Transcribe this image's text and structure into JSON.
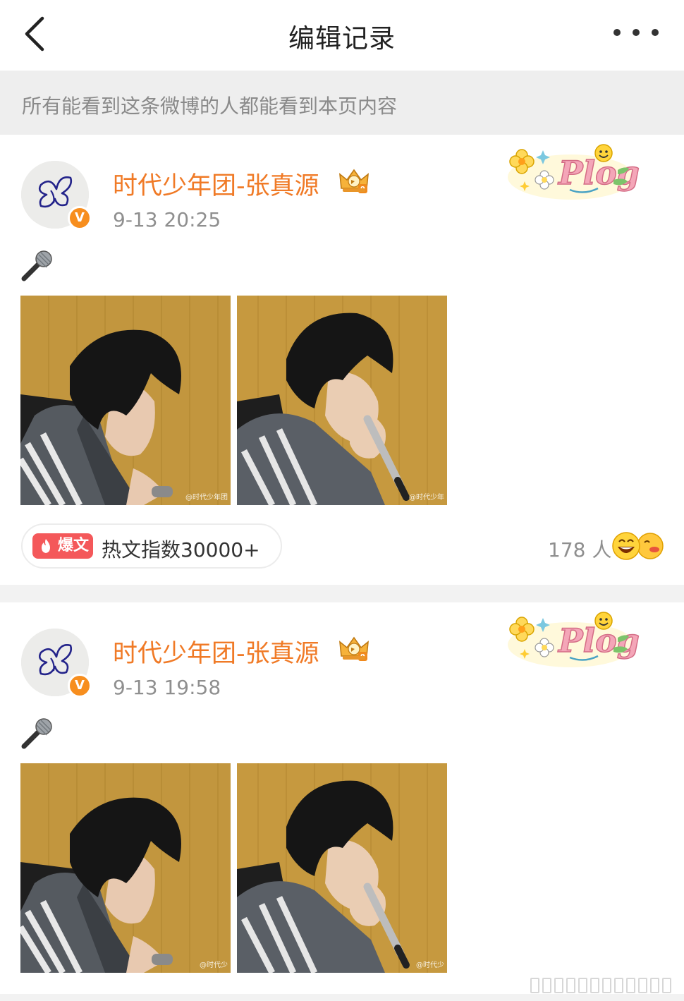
{
  "header": {
    "title": "编辑记录",
    "back_icon": "chevron-left-icon",
    "more_icon": "more-dots-icon"
  },
  "notice": {
    "text": "所有能看到这条微博的人都能看到本页内容"
  },
  "posts": [
    {
      "author": "时代少年团-张真源",
      "verified_icon": "verified-v-icon",
      "crown_icon": "crown-badge-icon",
      "sticker_icon": "plog-sticker-icon",
      "timestamp": "9-13 20:25",
      "content_emoji": "microphone-icon",
      "images": [
        {
          "name": "photo-looking-down",
          "watermark": "@时代少年团"
        },
        {
          "name": "photo-singing-microphone",
          "watermark": "@时代少年"
        }
      ],
      "hot_badge": "爆文",
      "hot_index": "热文指数30000+",
      "reaction_count": "178 人",
      "reaction_icon": "laugh-emoji-icon"
    },
    {
      "author": "时代少年团-张真源",
      "verified_icon": "verified-v-icon",
      "crown_icon": "crown-badge-icon",
      "sticker_icon": "plog-sticker-icon",
      "timestamp": "9-13 19:58",
      "content_emoji": "microphone-icon",
      "images": [
        {
          "name": "photo-looking-down",
          "watermark": "@时代少"
        },
        {
          "name": "photo-singing-microphone",
          "watermark": "@时代少"
        }
      ]
    }
  ],
  "colors": {
    "accent_orange": "#f07a26",
    "verified_orange": "#f78e1e",
    "hot_red": "#f4585a",
    "photo_background": "#c2963e"
  }
}
